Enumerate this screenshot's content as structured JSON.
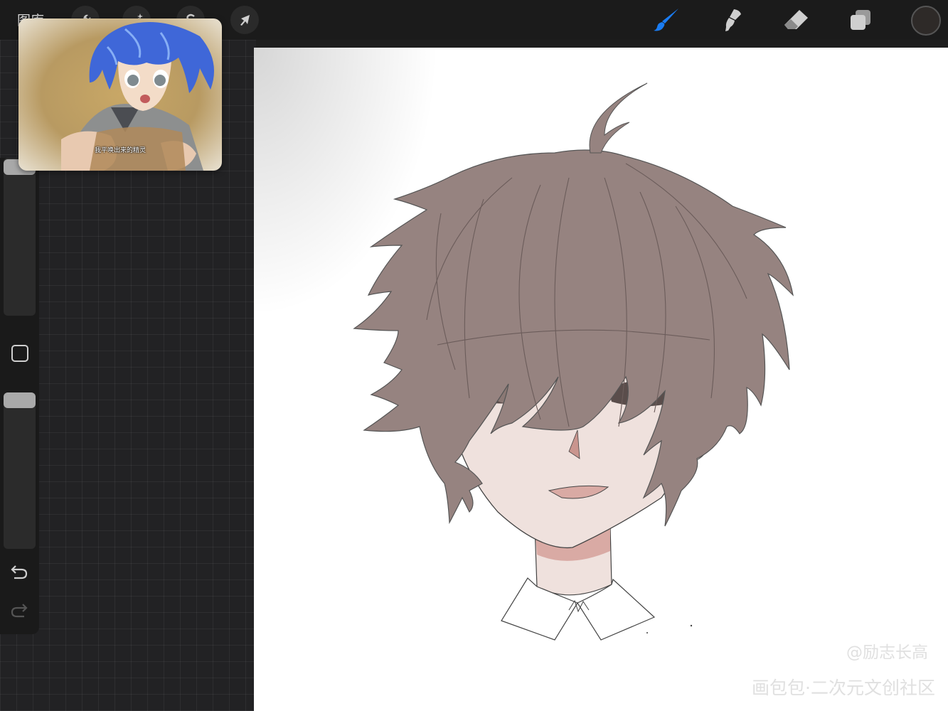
{
  "topbar": {
    "gallery_label": "图库",
    "left_tools": [
      "actions-wrench-icon",
      "adjustments-wand-icon",
      "selection-s-icon",
      "transform-arrow-icon"
    ],
    "right_tools": [
      "brush-icon",
      "smudge-icon",
      "eraser-icon",
      "layers-icon"
    ],
    "active_tool": "brush-icon",
    "accent_color": "#1a7cf2",
    "current_color": "#2e2a28"
  },
  "sidebar": {
    "brush_size_level": 0.0,
    "opacity_level": 1.0,
    "controls": [
      "modify-square-icon",
      "undo-icon",
      "redo-icon"
    ]
  },
  "reference": {
    "caption": "我平唤出来的精灵"
  },
  "canvas": {
    "background": "#ffffff",
    "hair_color": "#968380",
    "skin_color": "#efe1dd",
    "shadow_color": "#d9aaa4"
  },
  "watermark": {
    "handle": "@励志长高",
    "site": "画包包·二次元文创社区"
  }
}
